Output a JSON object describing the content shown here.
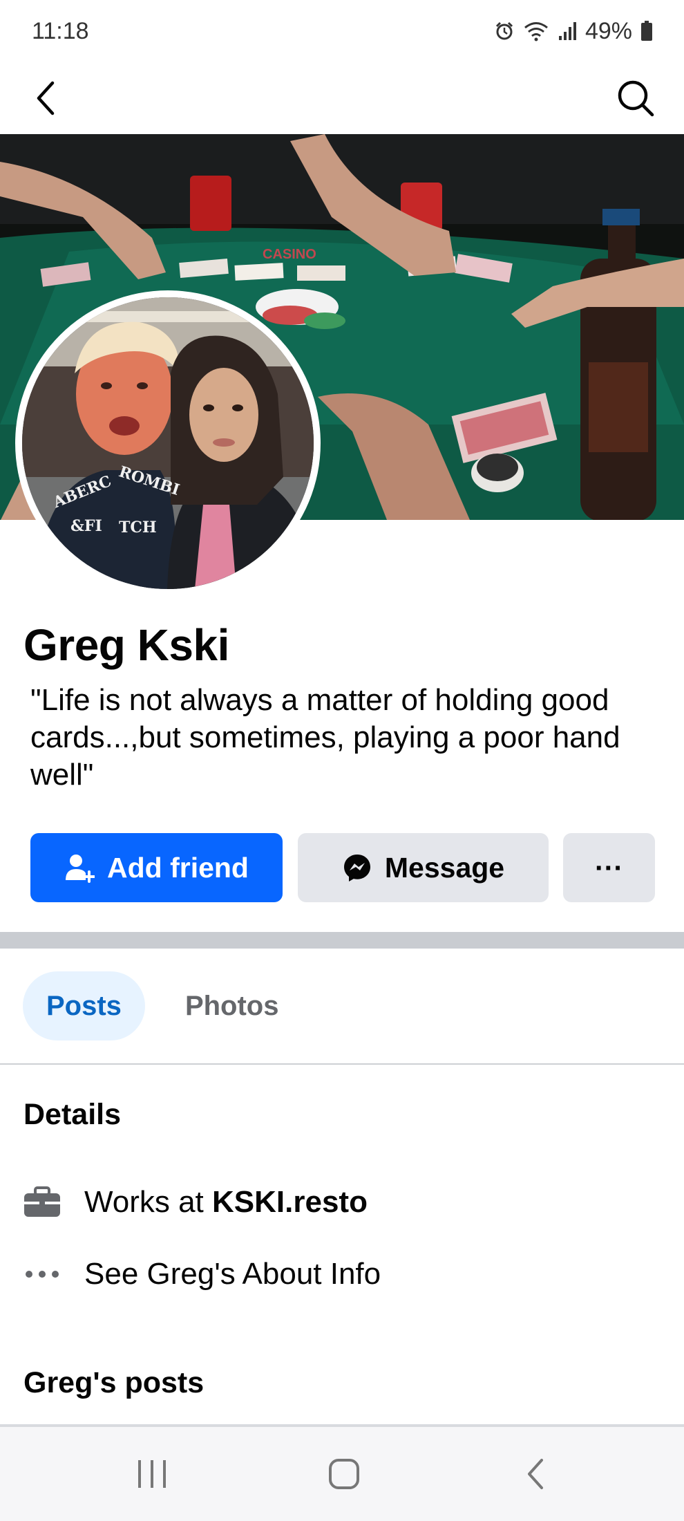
{
  "status_bar": {
    "time": "11:18",
    "battery": "49%",
    "icons": [
      "alarm-icon",
      "wifi-icon",
      "signal-icon",
      "battery-icon"
    ]
  },
  "app_bar": {
    "back_icon": "chevron-left-icon",
    "search_icon": "search-icon"
  },
  "profile": {
    "name": "Greg Kski",
    "bio": "\"Life is not always a matter of holding good cards...,but sometimes, playing a poor hand well\"",
    "avatar_text": [
      "ABERC",
      "ROMBI",
      "&FI",
      "TCH"
    ]
  },
  "actions": {
    "add_friend_label": "Add friend",
    "message_label": "Message",
    "more_label": "···"
  },
  "tabs": [
    {
      "label": "Posts",
      "active": true
    },
    {
      "label": "Photos",
      "active": false
    }
  ],
  "details": {
    "title": "Details",
    "work_prefix": "Works at ",
    "work_place": "KSKI.resto",
    "about_label": "See Greg's About Info"
  },
  "posts_section": {
    "title": "Greg's posts"
  },
  "colors": {
    "primary_blue": "#0866ff",
    "tab_active_bg": "#e7f3ff",
    "tab_active_text": "#0a66c2",
    "secondary_button": "#e4e6eb"
  },
  "nav_bar": {
    "icons": [
      "recents-icon",
      "home-icon",
      "back-icon"
    ]
  }
}
